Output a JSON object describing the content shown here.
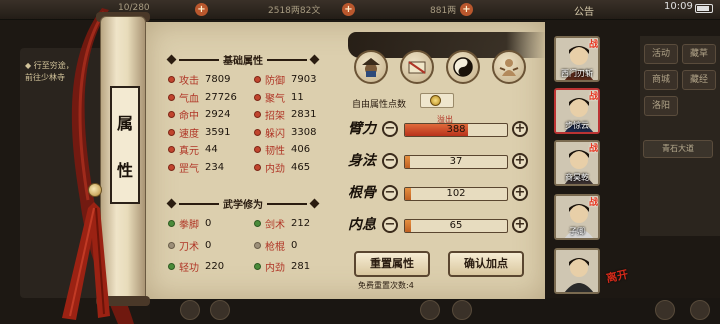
{
  "topbar": {
    "gold": "10/280",
    "silver": "2518两82文",
    "currency3": "881两",
    "announce": "公告",
    "clock": "10:09"
  },
  "quest": {
    "line1": "◆ 行至穷途，",
    "line2": "前往少林寺"
  },
  "right_menu": {
    "btn1": "活动",
    "btn2": "藏草",
    "btn3": "商城",
    "btn4": "藏经",
    "btn5": "洛阳",
    "road_label": "青石大道"
  },
  "scroll_title": [
    "属",
    "性"
  ],
  "basic_attrs": {
    "heading": "基础属性",
    "stats": [
      {
        "label": "攻击",
        "value": "7809",
        "color": "red"
      },
      {
        "label": "防御",
        "value": "7903",
        "color": "red"
      },
      {
        "label": "气血",
        "value": "27726",
        "color": "red"
      },
      {
        "label": "聚气",
        "value": "11",
        "color": "red"
      },
      {
        "label": "命中",
        "value": "2924",
        "color": "red"
      },
      {
        "label": "招架",
        "value": "2831",
        "color": "red"
      },
      {
        "label": "速度",
        "value": "3591",
        "color": "red"
      },
      {
        "label": "躲闪",
        "value": "3308",
        "color": "red"
      },
      {
        "label": "真元",
        "value": "44",
        "color": "red"
      },
      {
        "label": "韧性",
        "value": "406",
        "color": "red"
      },
      {
        "label": "罡气",
        "value": "234",
        "color": "red"
      },
      {
        "label": "内劲",
        "value": "465",
        "color": "red"
      }
    ]
  },
  "martial_attrs": {
    "heading": "武学修为",
    "stats": [
      {
        "label": "拳脚",
        "value": "0",
        "color": "green"
      },
      {
        "label": "剑术",
        "value": "212",
        "color": "green"
      },
      {
        "label": "刀术",
        "value": "0",
        "color": "gray"
      },
      {
        "label": "枪棍",
        "value": "0",
        "color": "gray"
      },
      {
        "label": "轻功",
        "value": "220",
        "color": "green"
      },
      {
        "label": "内劲",
        "value": "281",
        "color": "green"
      }
    ]
  },
  "free_points_label": "自由属性点数",
  "overflow_label": "溢出",
  "allocations": [
    {
      "label": "臂力",
      "value": "388",
      "fraction": 0.62
    },
    {
      "label": "身法",
      "value": "37",
      "fraction": 0.05
    },
    {
      "label": "根骨",
      "value": "102",
      "fraction": 0.06
    },
    {
      "label": "内息",
      "value": "65",
      "fraction": 0.06
    }
  ],
  "buttons": {
    "reset": "重置属性",
    "confirm": "确认加点"
  },
  "free_reset_text": "免费重置次数:4",
  "characters": [
    {
      "name": "西门刃斩"
    },
    {
      "name": "步惊云"
    },
    {
      "name": "商昊乾"
    },
    {
      "name": "子卿"
    },
    {
      "name": ""
    }
  ],
  "fight_tag": "战",
  "leave_tag": "离开"
}
